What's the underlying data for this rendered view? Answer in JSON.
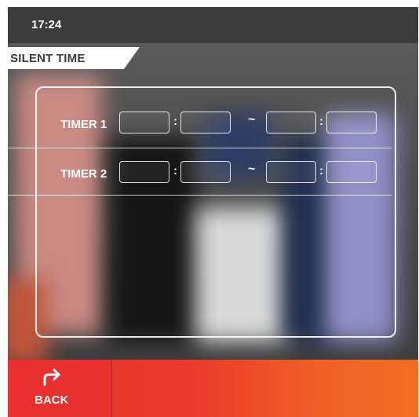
{
  "status_bar": {
    "time": "17:24"
  },
  "page": {
    "title": "SILENT TIME"
  },
  "timers": [
    {
      "label": "TIMER 1",
      "start_hour": "",
      "start_minute": "",
      "separator": ":",
      "range": "~",
      "end_hour": "",
      "end_minute": ""
    },
    {
      "label": "TIMER 2",
      "start_hour": "",
      "start_minute": "",
      "separator": ":",
      "range": "~",
      "end_hour": "",
      "end_minute": ""
    }
  ],
  "bottom_bar": {
    "back_label": "BACK",
    "back_icon": "return-arrow-icon"
  },
  "colors": {
    "accent": "#e8302e",
    "accent_end": "#f26e22",
    "panel_border": "#ffffff"
  }
}
